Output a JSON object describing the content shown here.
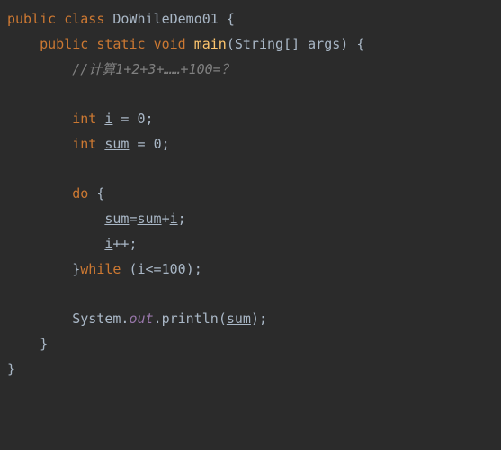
{
  "code": {
    "l1": {
      "kw1": "public",
      "kw2": "class",
      "name": "DoWhileDemo01",
      "brace": "{"
    },
    "l2": {
      "kw1": "public",
      "kw2": "static",
      "kw3": "void",
      "method": "main",
      "params": "(String[] args) {"
    },
    "l3": {
      "comment": "//计算1+2+3+……+100=？"
    },
    "l5": {
      "kw": "int",
      "var": "i",
      "rest": " = ",
      "val": "0",
      "semi": ";"
    },
    "l6": {
      "kw": "int",
      "var": "sum",
      "rest": " = ",
      "val": "0",
      "semi": ";"
    },
    "l8": {
      "kw": "do",
      "brace": " {"
    },
    "l9": {
      "v1": "sum",
      "eq": "=",
      "v2": "sum",
      "plus": "+",
      "v3": "i",
      "semi": ";"
    },
    "l10": {
      "v": "i",
      "op": "++;"
    },
    "l11": {
      "brace": "}",
      "kw": "while",
      "open": " (",
      "v": "i",
      "cond": "<=",
      "num": "100",
      "close": ");"
    },
    "l13": {
      "cls": "System.",
      "field": "out",
      "dot": ".",
      "m": "println",
      "open": "(",
      "v": "sum",
      "close": ");"
    },
    "l14": {
      "brace": "}"
    },
    "l15": {
      "brace": "}"
    }
  }
}
